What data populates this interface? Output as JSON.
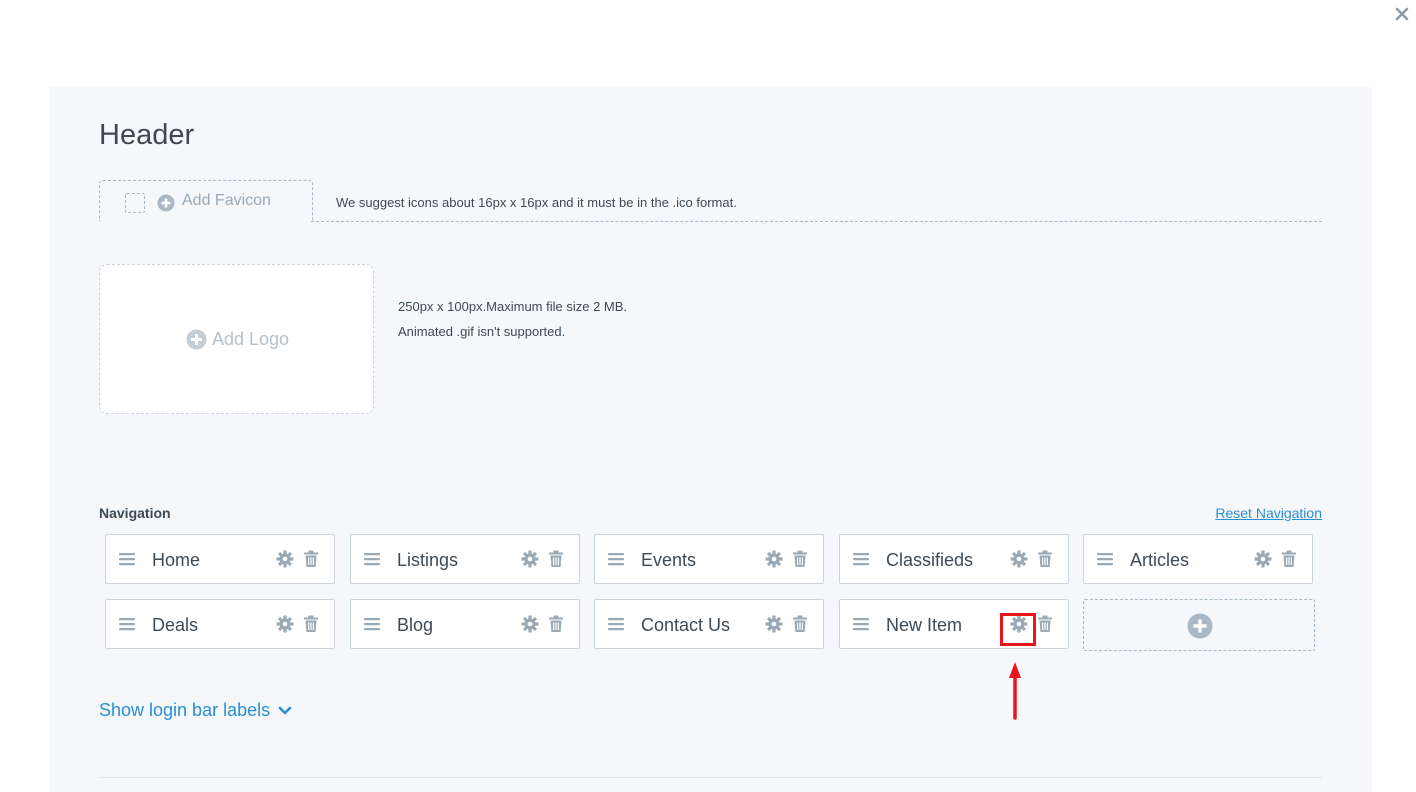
{
  "header": {
    "title": "Header"
  },
  "favicon": {
    "add_label": "Add Favicon",
    "hint": "We suggest icons about 16px x 16px and it must be in the .ico format."
  },
  "logo": {
    "add_label": "Add Logo",
    "hint_line1": "250px x 100px.Maximum file size 2 MB.",
    "hint_line2": "Animated .gif isn't supported."
  },
  "navigation": {
    "heading": "Navigation",
    "reset_label": "Reset Navigation",
    "items": [
      {
        "label": "Home"
      },
      {
        "label": "Listings"
      },
      {
        "label": "Events"
      },
      {
        "label": "Classifieds"
      },
      {
        "label": "Articles"
      },
      {
        "label": "Deals"
      },
      {
        "label": "Blog"
      },
      {
        "label": "Contact Us"
      },
      {
        "label": "New Item"
      }
    ]
  },
  "login_bar": {
    "toggle_label": "Show login bar labels"
  },
  "colors": {
    "accent": "#2a8fd0",
    "icon": "#9aa9b6",
    "annotation": "#e8161b",
    "panel": "#f5f7fa"
  },
  "icons": {
    "close": "close-icon",
    "favicon_add": "plus-circle-icon",
    "drag": "drag-handle-icon",
    "settings": "gear-icon",
    "delete": "trash-icon",
    "add_item": "plus-circle-icon",
    "expand": "chevron-down-icon"
  }
}
